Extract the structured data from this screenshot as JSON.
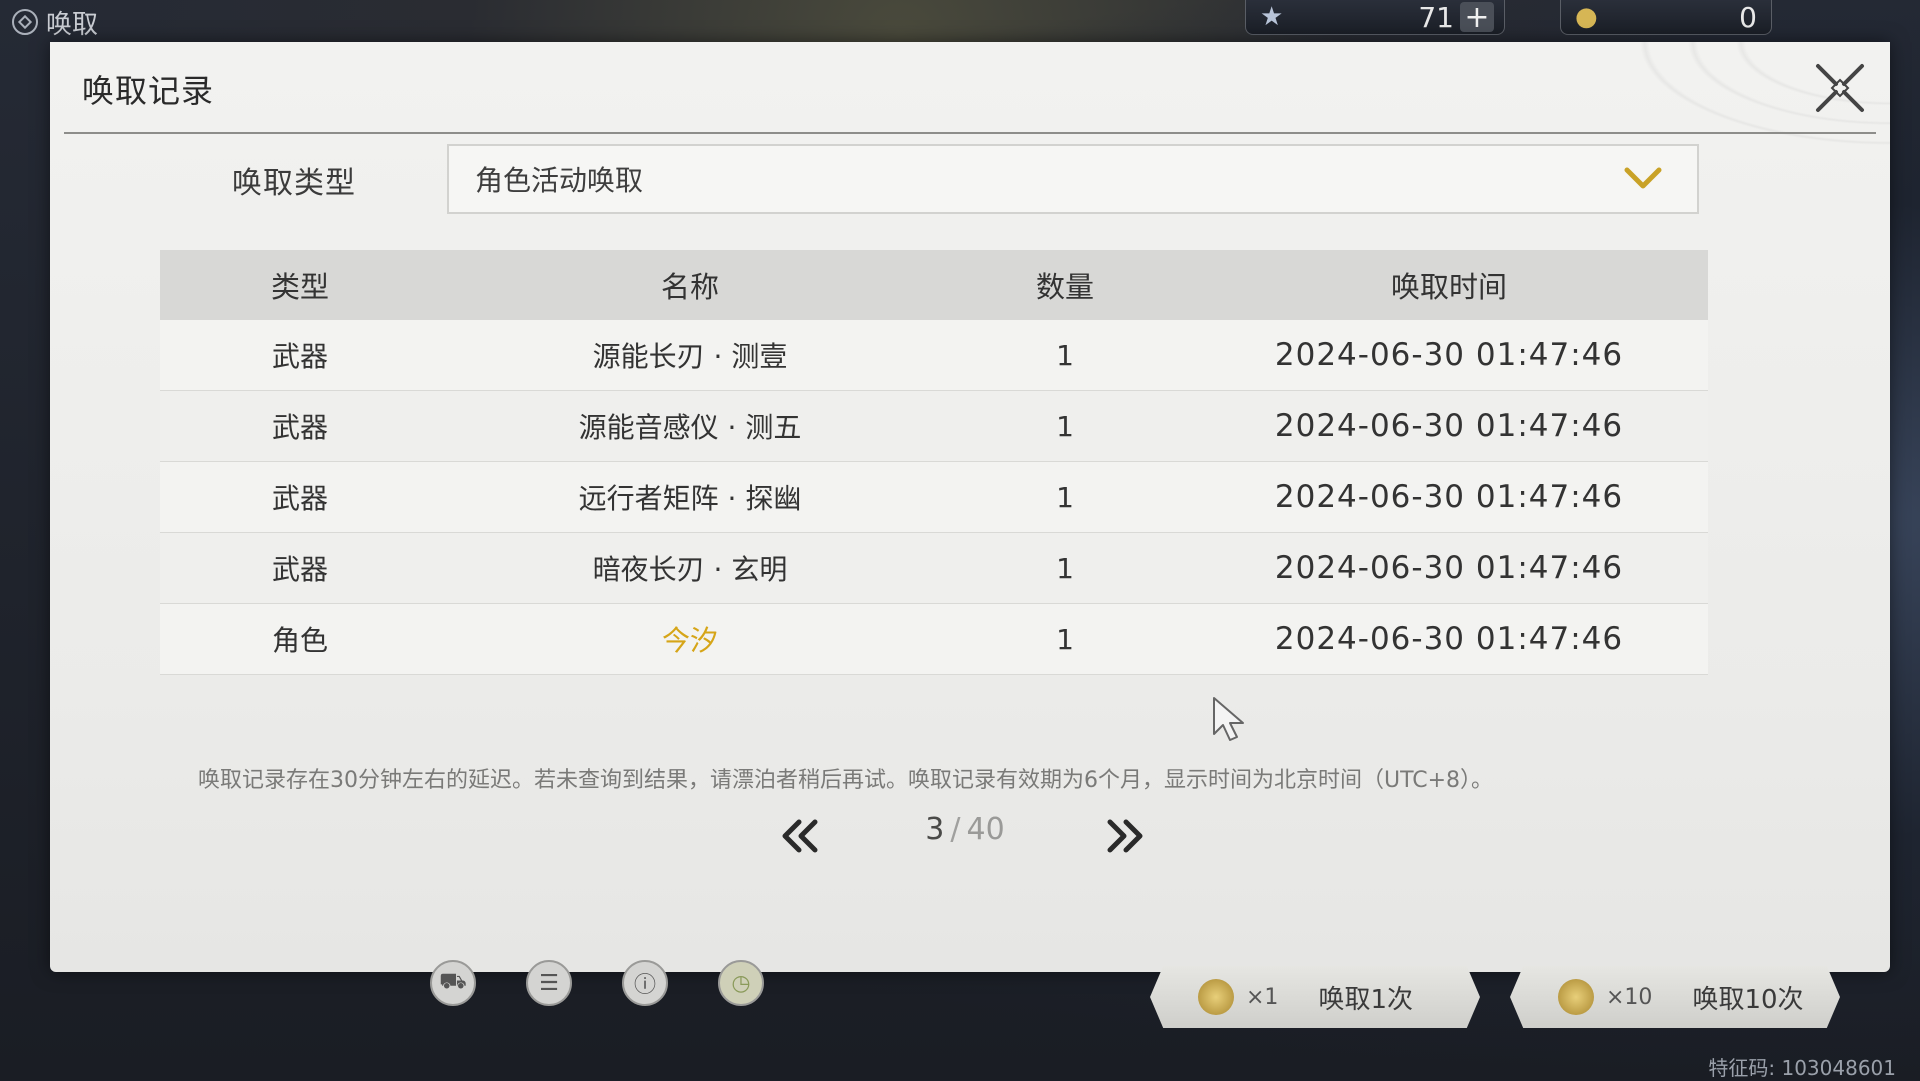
{
  "topbar": {
    "app_title": "唤取",
    "currency_1": {
      "icon": "star-icon",
      "value": "71"
    },
    "currency_2": {
      "icon": "coin-icon",
      "value": "0"
    }
  },
  "modal": {
    "title": "唤取记录",
    "filter": {
      "label": "唤取类型",
      "value": "角色活动唤取"
    },
    "table": {
      "headers": [
        "类型",
        "名称",
        "数量",
        "唤取时间"
      ],
      "rows": [
        {
          "type": "武器",
          "name": "源能长刃 · 测壹",
          "qty": "1",
          "time": "2024-06-30 01:47:46",
          "highlight": false
        },
        {
          "type": "武器",
          "name": "源能音感仪 · 测五",
          "qty": "1",
          "time": "2024-06-30 01:47:46",
          "highlight": false
        },
        {
          "type": "武器",
          "name": "远行者矩阵 · 探幽",
          "qty": "1",
          "time": "2024-06-30 01:47:46",
          "highlight": false
        },
        {
          "type": "武器",
          "name": "暗夜长刃 · 玄明",
          "qty": "1",
          "time": "2024-06-30 01:47:46",
          "highlight": false
        },
        {
          "type": "角色",
          "name": "今汐",
          "qty": "1",
          "time": "2024-06-30 01:47:46",
          "highlight": true
        }
      ]
    },
    "note": "唤取记录存在30分钟左右的延迟。若未查询到结果，请漂泊者稍后再试。唤取记录有效期为6个月，显示时间为北京时间（UTC+8）。",
    "pager": {
      "current": "3",
      "total": "40",
      "separator": "/"
    }
  },
  "bottom": {
    "pull_1": {
      "mult": "×1",
      "label": "唤取1次"
    },
    "pull_10": {
      "mult": "×10",
      "label": "唤取10次"
    },
    "footer_id": "特征码: 103048601"
  },
  "colors": {
    "highlight_gold": "#d6a518",
    "chevron_gold": "#c9a227"
  }
}
